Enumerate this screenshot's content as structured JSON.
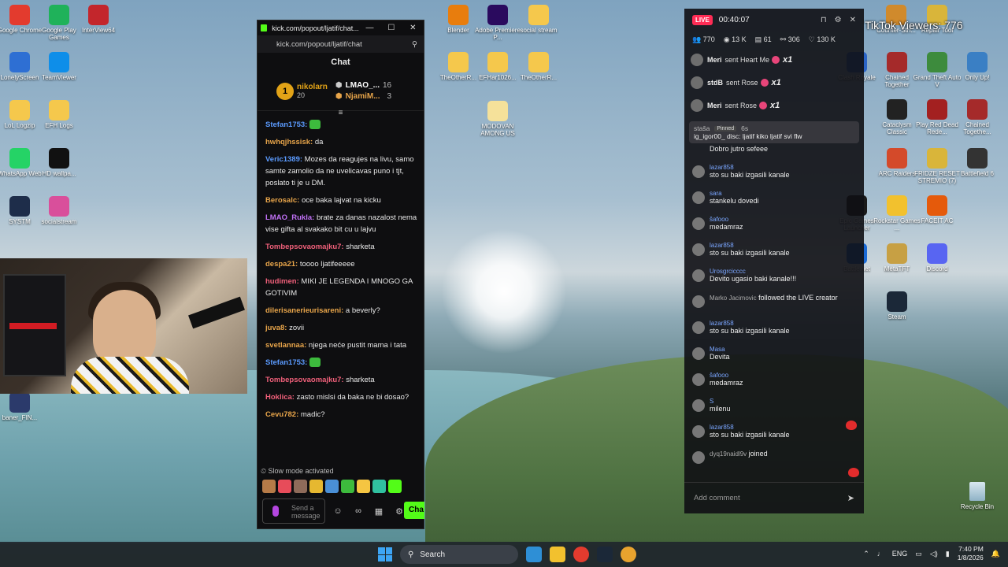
{
  "desktop_icons_left": [
    {
      "label": "Google Chrome",
      "color": "#e33b2e"
    },
    {
      "label": "Google Play Games",
      "color": "#1fb25a"
    },
    {
      "label": "InterView64",
      "color": "#c3262c"
    },
    {
      "label": "LonelyScreen",
      "color": "#2e6fd3"
    },
    {
      "label": "TeamViewer",
      "color": "#0e8ee9"
    },
    {
      "label": "LoL Logzip",
      "color": "#f5c84c"
    },
    {
      "label": "EFH Logs",
      "color": "#f5c84c"
    },
    {
      "label": "WhatsApp Web",
      "color": "#25d366"
    },
    {
      "label": "HD wallpa...",
      "color": "#111111"
    },
    {
      "label": "SYSTM",
      "color": "#1e2d4a"
    },
    {
      "label": "socialstream",
      "color": "#d94f9b"
    },
    {
      "label": "baner_FIN...",
      "color": "#2b3a6b"
    }
  ],
  "desktop_icons_mid": [
    {
      "label": "Blender",
      "color": "#e87d0d"
    },
    {
      "label": "Adobe Premiere P...",
      "color": "#2a0a5e"
    },
    {
      "label": "social stream",
      "color": "#f5c84c"
    },
    {
      "label": "TheOtherR...",
      "color": "#f5c84c"
    },
    {
      "label": "EFHar1026...",
      "color": "#f5c84c"
    },
    {
      "label": "TheOtherR...",
      "color": "#f5c84c"
    },
    {
      "label": "MODOVAN AMONG US",
      "color": "#f5e19a"
    }
  ],
  "kick": {
    "window_title": "kick.com/popout/ljatif/chat...",
    "url": "kick.com/popout/ljatif/chat",
    "chat_title": "Chat",
    "top_gifter": {
      "rank": "1",
      "name": "nikolarn",
      "count": "20"
    },
    "gifters": [
      {
        "name": "LMAO_...",
        "count": "16"
      },
      {
        "name": "NjamiM...",
        "count": "3"
      }
    ],
    "messages": [
      {
        "user": "Stefan1753:",
        "color": "#5b9bff",
        "text": ""
      },
      {
        "user": "hwhqjhssisk:",
        "color": "#e8a54a",
        "text": "da"
      },
      {
        "user": "Veric1389:",
        "color": "#5b9bff",
        "text": "Mozes da reagujes na livu, samo samte zamolio da ne uvelicavas puno i tjt, poslato ti je u DM."
      },
      {
        "user": "Berosalc:",
        "color": "#e8a54a",
        "text": "oce baka lajvat na kicku"
      },
      {
        "user": "LMAO_Rukla:",
        "color": "#c071f5",
        "text": "brate za danas nazalost nema vise gifta al svakako bit cu u lajvu"
      },
      {
        "user": "Tombepsovaomajku7:",
        "color": "#f0607a",
        "text": "sharketa"
      },
      {
        "user": "despa21:",
        "color": "#e8a54a",
        "text": "toooo ljatifeeeee"
      },
      {
        "user": "hudimen:",
        "color": "#f0607a",
        "text": "MIKI JE LEGENDA I MNOGO GA GOTIVIM"
      },
      {
        "user": "dilerisanerieurisareni:",
        "color": "#e8a54a",
        "text": "a beverly?"
      },
      {
        "user": "juva8:",
        "color": "#e8a54a",
        "text": "zovii"
      },
      {
        "user": "svetlannaa:",
        "color": "#e8a54a",
        "text": "njega neće pustit mama i tata"
      },
      {
        "user": "Stefan1753:",
        "color": "#5b9bff",
        "text": ""
      },
      {
        "user": "Tombepsovaomajku7:",
        "color": "#f0607a",
        "text": "sharketa"
      },
      {
        "user": "Hoklica:",
        "color": "#f0607a",
        "text": "zasto mislsi da baka ne bi dosao?"
      },
      {
        "user": "Cevu782:",
        "color": "#e8a54a",
        "text": "madic?"
      }
    ],
    "slow_mode": "Slow mode activated",
    "input_placeholder": "Send a message",
    "send_label": "Cha"
  },
  "tiktok": {
    "live_label": "LIVE",
    "timer": "00:40:07",
    "stats": {
      "viewers": "770",
      "views": "13 K",
      "shares": "61",
      "followers": "306",
      "likes": "130 K"
    },
    "gifts": [
      {
        "user": "Meri",
        "sent": "sent Heart Me",
        "mult": "x1"
      },
      {
        "user": "stdB",
        "sent": "sent Rose",
        "mult": "x1"
      },
      {
        "user": "Meri",
        "sent": "sent Rose",
        "mult": "x1"
      }
    ],
    "pinned": {
      "user": "staša",
      "tag": "Pinned",
      "time": "6s",
      "text": "ig_igor00_ disc: ljatif kiko ljatif svi flw"
    },
    "comments": [
      {
        "user": "",
        "text": "Dobro jutro sefeee",
        "sys": false
      },
      {
        "user": "lazar858",
        "text": "sto su baki izgasili kanale",
        "sys": false
      },
      {
        "user": "sara",
        "text": "stankelu dovedi",
        "sys": false
      },
      {
        "user": "šafooo",
        "text": "medamraz",
        "sys": false
      },
      {
        "user": "lazar858",
        "text": "sto su baki izgasili kanale",
        "sys": false
      },
      {
        "user": "Urosgrcicccc",
        "text": "Devito ugasio baki kanale!!!",
        "sys": false
      },
      {
        "user": "Marko Jacimovic",
        "text": "followed the LIVE creator",
        "sys": true
      },
      {
        "user": "lazar858",
        "text": "sto su baki izgasili kanale",
        "sys": false
      },
      {
        "user": "Masa",
        "text": "Devita",
        "sys": false
      },
      {
        "user": "šafooo",
        "text": "medamraz",
        "sys": false
      },
      {
        "user": "S",
        "text": "milenu",
        "sys": false
      },
      {
        "user": "lazar858",
        "text": "sto su baki izgasili kanale",
        "sys": false
      },
      {
        "user": "dyq19naidl9v",
        "text": "joined",
        "sys": true
      }
    ],
    "add_comment": "Add comment"
  },
  "tiktok_viewers": "TikTok Viewers: 776",
  "desktop_icons_right": [
    {
      "label": "Counter-Stri...",
      "color": "#d08a2c"
    },
    {
      "label": "Repair Tool",
      "color": "#d9b53a"
    },
    {
      "label": "Clash Royale",
      "color": "#2b64c6"
    },
    {
      "label": "Chained Together",
      "color": "#a52a2a"
    },
    {
      "label": "Grand Theft Auto V",
      "color": "#3d8b3d"
    },
    {
      "label": "Only Up!",
      "color": "#3a7fc4"
    },
    {
      "label": "Cataclysm Classic",
      "color": "#222222"
    },
    {
      "label": "Play Red Dead Rede...",
      "color": "#a32020"
    },
    {
      "label": "Chained Togethe...",
      "color": "#a52a2a"
    },
    {
      "label": "ARC Raiders",
      "color": "#d44a2a"
    },
    {
      "label": "FRIDZE RESET STREMIO (7)",
      "color": "#d9b53a"
    },
    {
      "label": "Battlefield 6",
      "color": "#333333"
    },
    {
      "label": "Epic Games Launcher",
      "color": "#1a1a1a"
    },
    {
      "label": "Rockstar Games ...",
      "color": "#f2c12e"
    },
    {
      "label": "FACEIT AC",
      "color": "#e55a0b"
    },
    {
      "label": "Battle.net",
      "color": "#1a6ad6"
    },
    {
      "label": "MetaTFT",
      "color": "#c7a044"
    },
    {
      "label": "Discord",
      "color": "#5865f2"
    },
    {
      "label": "Steam",
      "color": "#1b2838"
    }
  ],
  "recycle_bin": "Recycle Bin",
  "taskbar": {
    "search_label": "Search",
    "lang": "ENG",
    "time": "7:40 PM",
    "date": "1/8/2026"
  }
}
